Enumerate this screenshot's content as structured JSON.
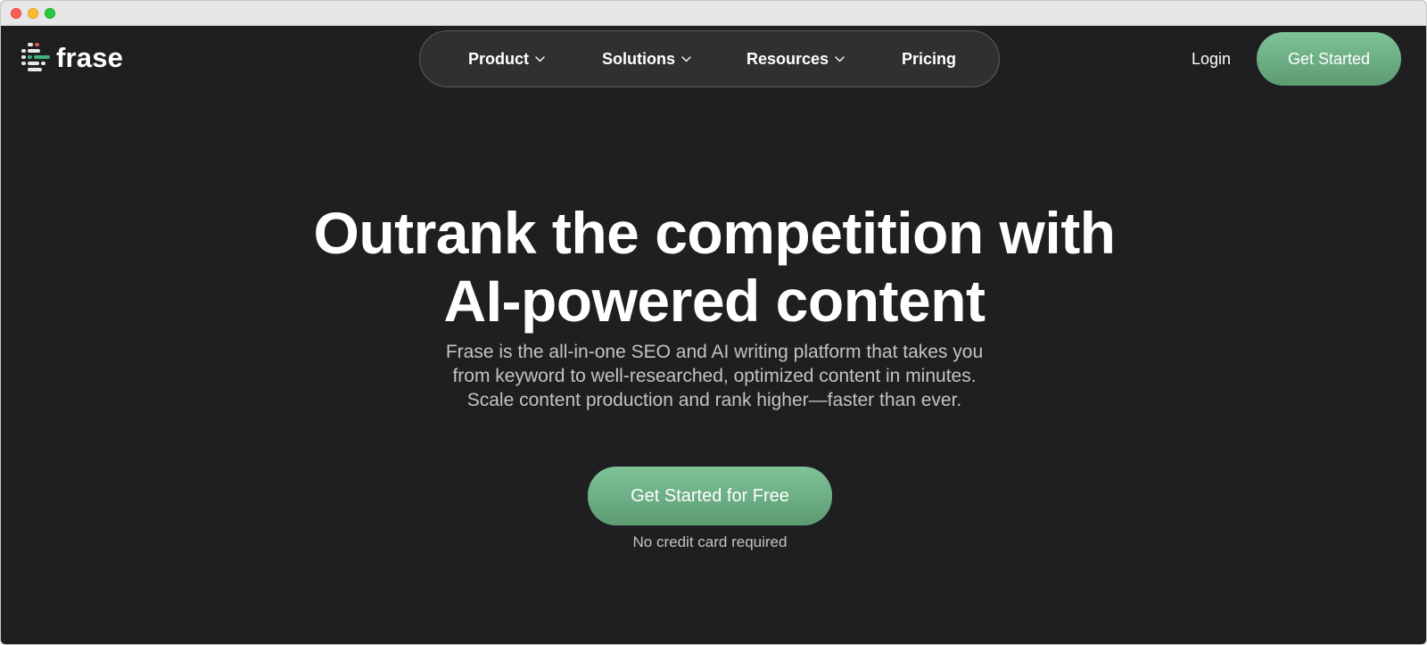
{
  "browser": {
    "traffic_lights": [
      "close",
      "minimize",
      "zoom"
    ]
  },
  "header": {
    "logo_text": "frase",
    "nav": [
      {
        "label": "Product",
        "has_dropdown": true
      },
      {
        "label": "Solutions",
        "has_dropdown": true
      },
      {
        "label": "Resources",
        "has_dropdown": true
      },
      {
        "label": "Pricing",
        "has_dropdown": false
      }
    ],
    "login_label": "Login",
    "get_started_label": "Get Started"
  },
  "hero": {
    "headline_line1": "Outrank the competition with",
    "headline_line2": "AI-powered content",
    "sub_line1": "Frase is the all-in-one SEO and AI writing platform that takes you",
    "sub_line2": "from keyword to well-researched, optimized content in minutes.",
    "sub_line3": "Scale content production and rank higher—faster than ever.",
    "cta_label": "Get Started for Free",
    "cta_note": "No credit card required"
  },
  "colors": {
    "background": "#1f1f21",
    "nav_pill": "#2f3032",
    "accent_green_top": "#7fc398",
    "accent_green_bottom": "#5d9b73",
    "text_primary": "#ffffff",
    "text_secondary": "#c3c3c6"
  },
  "icons": {
    "logo": "frase-logo-icon",
    "dropdown": "chevron-down-icon"
  }
}
